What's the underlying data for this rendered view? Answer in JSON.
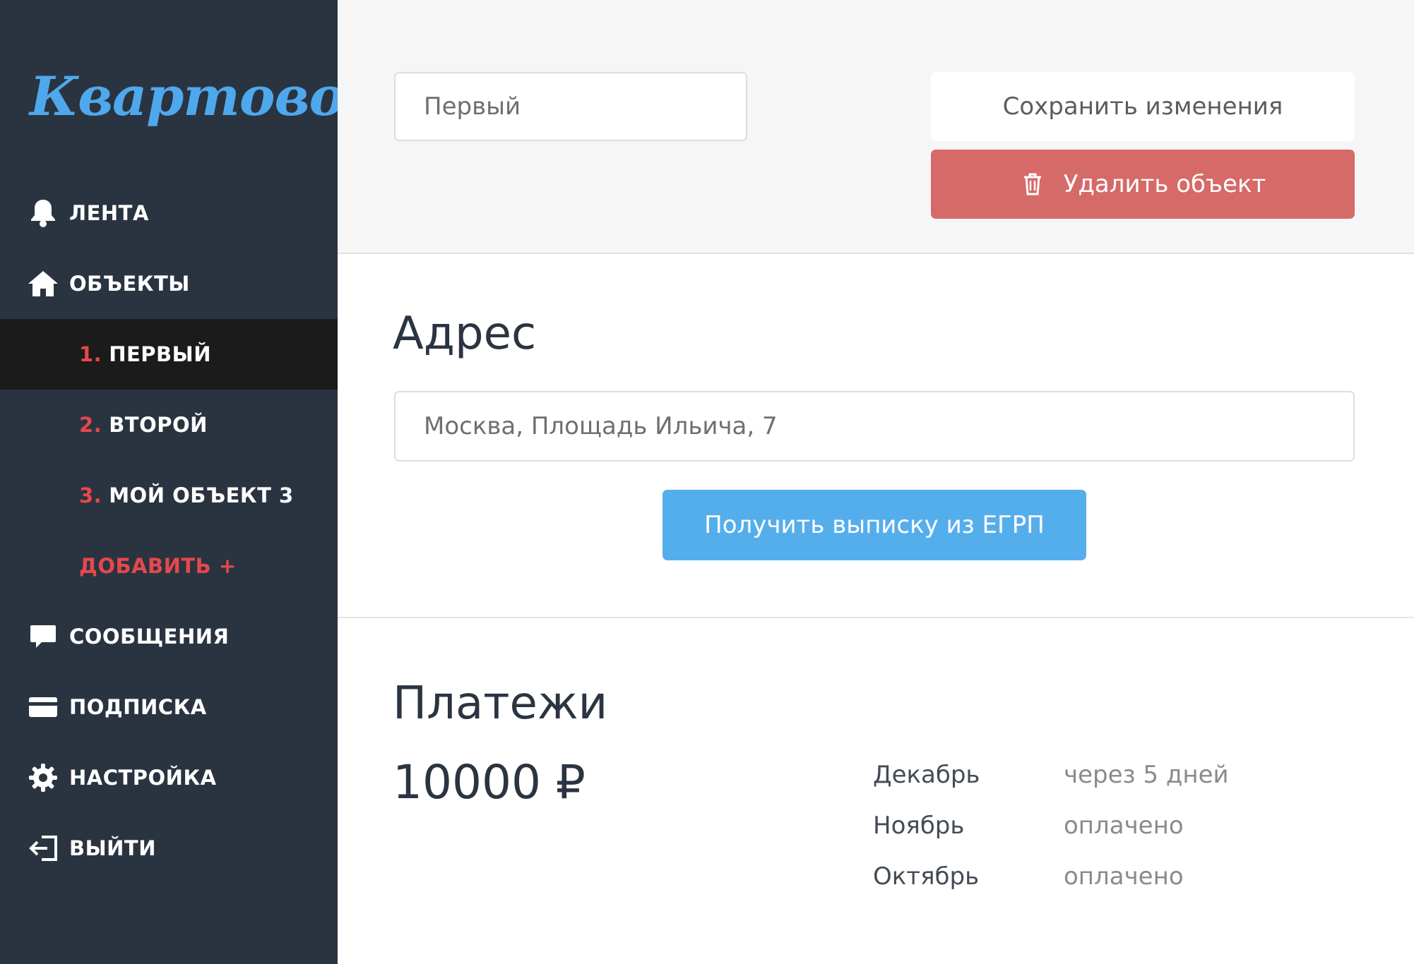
{
  "app": {
    "logo_text": "Квартовод"
  },
  "sidebar": {
    "items": [
      {
        "label": "ЛЕНТА",
        "icon": "bell-icon"
      },
      {
        "label": "ОБЪЕКТЫ",
        "icon": "home-icon"
      },
      {
        "label": "СООБЩЕНИЯ",
        "icon": "chat-icon"
      },
      {
        "label": "ПОДПИСКА",
        "icon": "credit-card-icon"
      },
      {
        "label": "НАСТРОЙКА",
        "icon": "gear-icon"
      },
      {
        "label": "ВЫЙТИ",
        "icon": "logout-icon"
      }
    ],
    "objects": [
      {
        "num": "1.",
        "label": "ПЕРВЫЙ",
        "active": true
      },
      {
        "num": "2.",
        "label": "ВТОРОЙ",
        "active": false
      },
      {
        "num": "3.",
        "label": "МОЙ ОБЪЕКТ 3",
        "active": false
      }
    ],
    "add_label": "ДОБАВИТЬ +"
  },
  "header": {
    "name_value": "Первый",
    "save_label": "Сохранить изменения",
    "delete_label": "Удалить объект",
    "delete_icon": "trash-icon"
  },
  "address": {
    "title": "Адрес",
    "value": "Москва, Площадь Ильича, 7",
    "egrp_label": "Получить выписку из ЕГРП"
  },
  "payments": {
    "title": "Платежи",
    "amount": "10000 ₽",
    "rows": [
      {
        "month": "Декабрь",
        "status": "через 5 дней"
      },
      {
        "month": "Ноябрь",
        "status": "оплачено"
      },
      {
        "month": "Октябрь",
        "status": "оплачено"
      }
    ]
  },
  "colors": {
    "sidebar_bg": "#2a3441",
    "active_item_bg": "#1b1b1b",
    "accent_red": "#e5484d",
    "logo_blue": "#4fa8ec",
    "delete_button": "#d66a68",
    "primary_button": "#55aeec"
  }
}
